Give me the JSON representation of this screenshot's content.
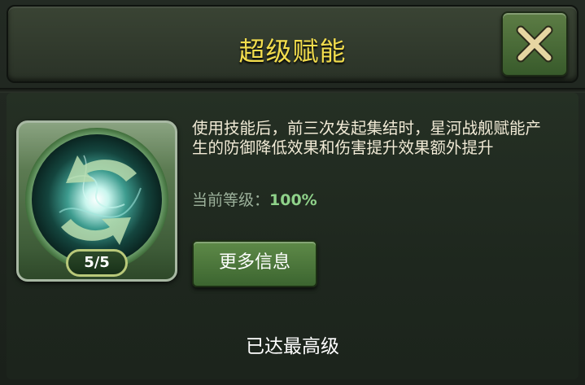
{
  "header": {
    "title": "超级赋能"
  },
  "close_button": {
    "icon": "close-icon"
  },
  "skill": {
    "icon": "refresh-energy-orb-icon",
    "level_badge": "5/5",
    "description": "使用技能后，前三次发起集结时，星河战舰赋能产生的防御降低效果和伤害提升效果额外提升",
    "current_level_label": "当前等级：",
    "current_level_value": "100%"
  },
  "more_info_button": {
    "label": "更多信息"
  },
  "status": {
    "max_level_text": "已达最高级"
  },
  "colors": {
    "title": "#f2dd4d",
    "level_value": "#8fd28a",
    "button_green": "#4f7a3d"
  }
}
